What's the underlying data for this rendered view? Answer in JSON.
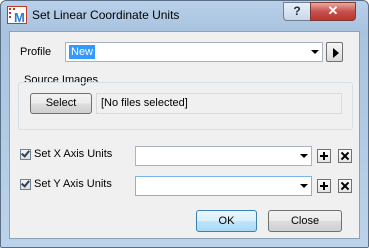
{
  "window": {
    "title": "Set Linear Coordinate Units",
    "help_label": "?",
    "close_label": "✕",
    "app_icon": "app-logo-icon"
  },
  "profile": {
    "label": "Profile",
    "value": "New"
  },
  "source_images": {
    "group_label": "Source Images",
    "select_label": "Select",
    "status": "[No files selected]"
  },
  "x_axis": {
    "label": "Set X Axis Units",
    "checked": true,
    "value": ""
  },
  "y_axis": {
    "label": "Set Y Axis Units",
    "checked": true,
    "value": ""
  },
  "buttons": {
    "ok": "OK",
    "close": "Close"
  },
  "colors": {
    "selection": "#3399ff",
    "close_button": "#c75050"
  }
}
